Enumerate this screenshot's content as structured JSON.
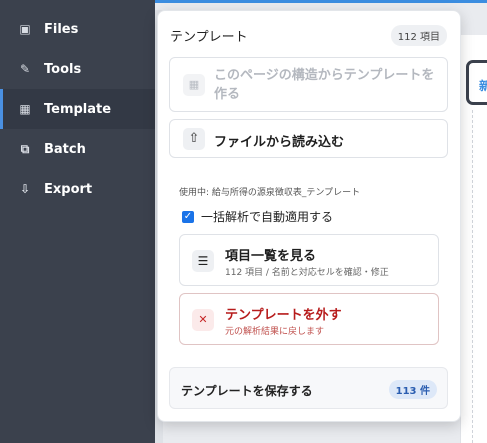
{
  "sidebar": {
    "items": [
      {
        "label": "Files",
        "icon": "file-icon",
        "glyph": "▣"
      },
      {
        "label": "Tools",
        "icon": "pen-icon",
        "glyph": "✎"
      },
      {
        "label": "Template",
        "icon": "grid-icon",
        "glyph": "▦",
        "active": true
      },
      {
        "label": "Batch",
        "icon": "stack-icon",
        "glyph": "⧉"
      },
      {
        "label": "Export",
        "icon": "download-icon",
        "glyph": "⇩"
      }
    ]
  },
  "right_card": {
    "glyph": "新"
  },
  "dropdown": {
    "title": "テンプレート",
    "count_badge": "112 項目",
    "create_from_page": {
      "label": "このページの構造からテンプレートを作る",
      "icon": "grid-icon",
      "glyph": "▦"
    },
    "load_from_file": {
      "label": "ファイルから読み込む",
      "icon": "upload-icon",
      "glyph": "⇧"
    },
    "in_use": "使用中: 給与所得の源泉徴収表_テンプレート",
    "auto_apply": {
      "label": "一括解析で自動適用する",
      "checked": true,
      "glyph": "✓"
    },
    "view_items": {
      "title": "項目一覧を見る",
      "subtitle": "112 項目 / 名前と対応セルを確認・修正",
      "icon": "list-icon",
      "glyph": "☰"
    },
    "remove_template": {
      "title": "テンプレートを外す",
      "subtitle": "元の解析結果に戻します",
      "icon": "close-icon",
      "glyph": "✕"
    },
    "save_template": {
      "label": "テンプレートを保存する",
      "badge": "113 件"
    }
  },
  "colors": {
    "accent": "#1a73e8",
    "sidebar_bg": "#3b414d",
    "danger": "#b71c1c"
  }
}
